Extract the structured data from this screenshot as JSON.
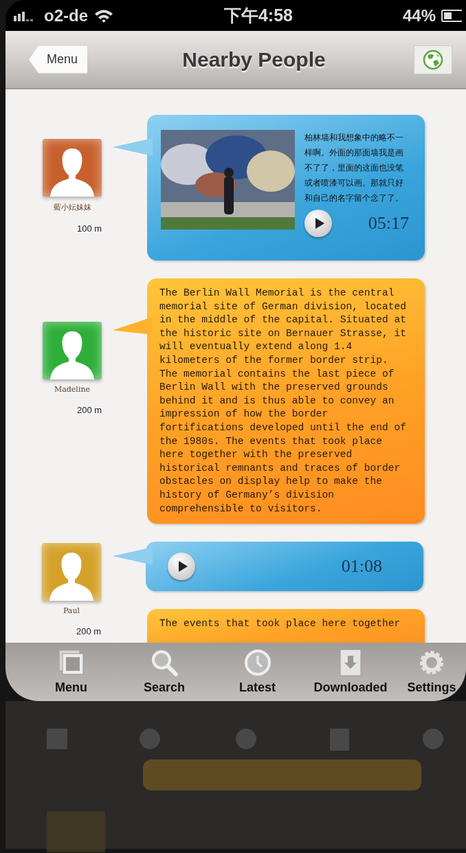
{
  "status_bar": {
    "carrier": "o2-de",
    "time": "下午4:58",
    "battery": "44%"
  },
  "nav_bar": {
    "back_button": "Menu",
    "title": "Nearby People"
  },
  "posts": [
    {
      "name": "藍小妘妹妹",
      "distance": "100 m",
      "color": "#c8602e",
      "kind": "video",
      "text": "柏林墙和我想象中的略不一样啊。外面的那面墙我是画不了了，里面的这面也没笔或者喷漆可以画。那就只好和自己的名字留个念了了。",
      "duration": "05:17"
    },
    {
      "name": "Madeline",
      "distance": "200 m",
      "color": "#2fae3a",
      "kind": "text",
      "text": "The Berlin Wall Memorial is the central memorial site of German division, located in the middle of the capital. Situated at the historic site on Bernauer Strasse, it will eventually extend along 1.4 kilometers of the former border strip. The memorial contains the last piece of Berlin Wall with the preserved grounds behind it and is thus able to convey an impression of how the border fortifications developed until the end of the 1980s. The events that took place here together with the preserved historical remnants and traces of border obstacles on display help to make the history of Germany’s division comprehensible to visitors."
    },
    {
      "name": "Paul",
      "distance": "200 m",
      "color": "#d4a22a",
      "kind": "audio",
      "duration": "01:08"
    },
    {
      "kind": "text",
      "text": "The events that took place here together"
    }
  ],
  "tab_bar": [
    {
      "label": "Menu",
      "kind": "menu"
    },
    {
      "label": "Search",
      "kind": "search"
    },
    {
      "label": "Latest",
      "kind": "clock"
    },
    {
      "label": "Downloaded",
      "kind": "download"
    },
    {
      "label": "Settings",
      "kind": "settings"
    }
  ]
}
